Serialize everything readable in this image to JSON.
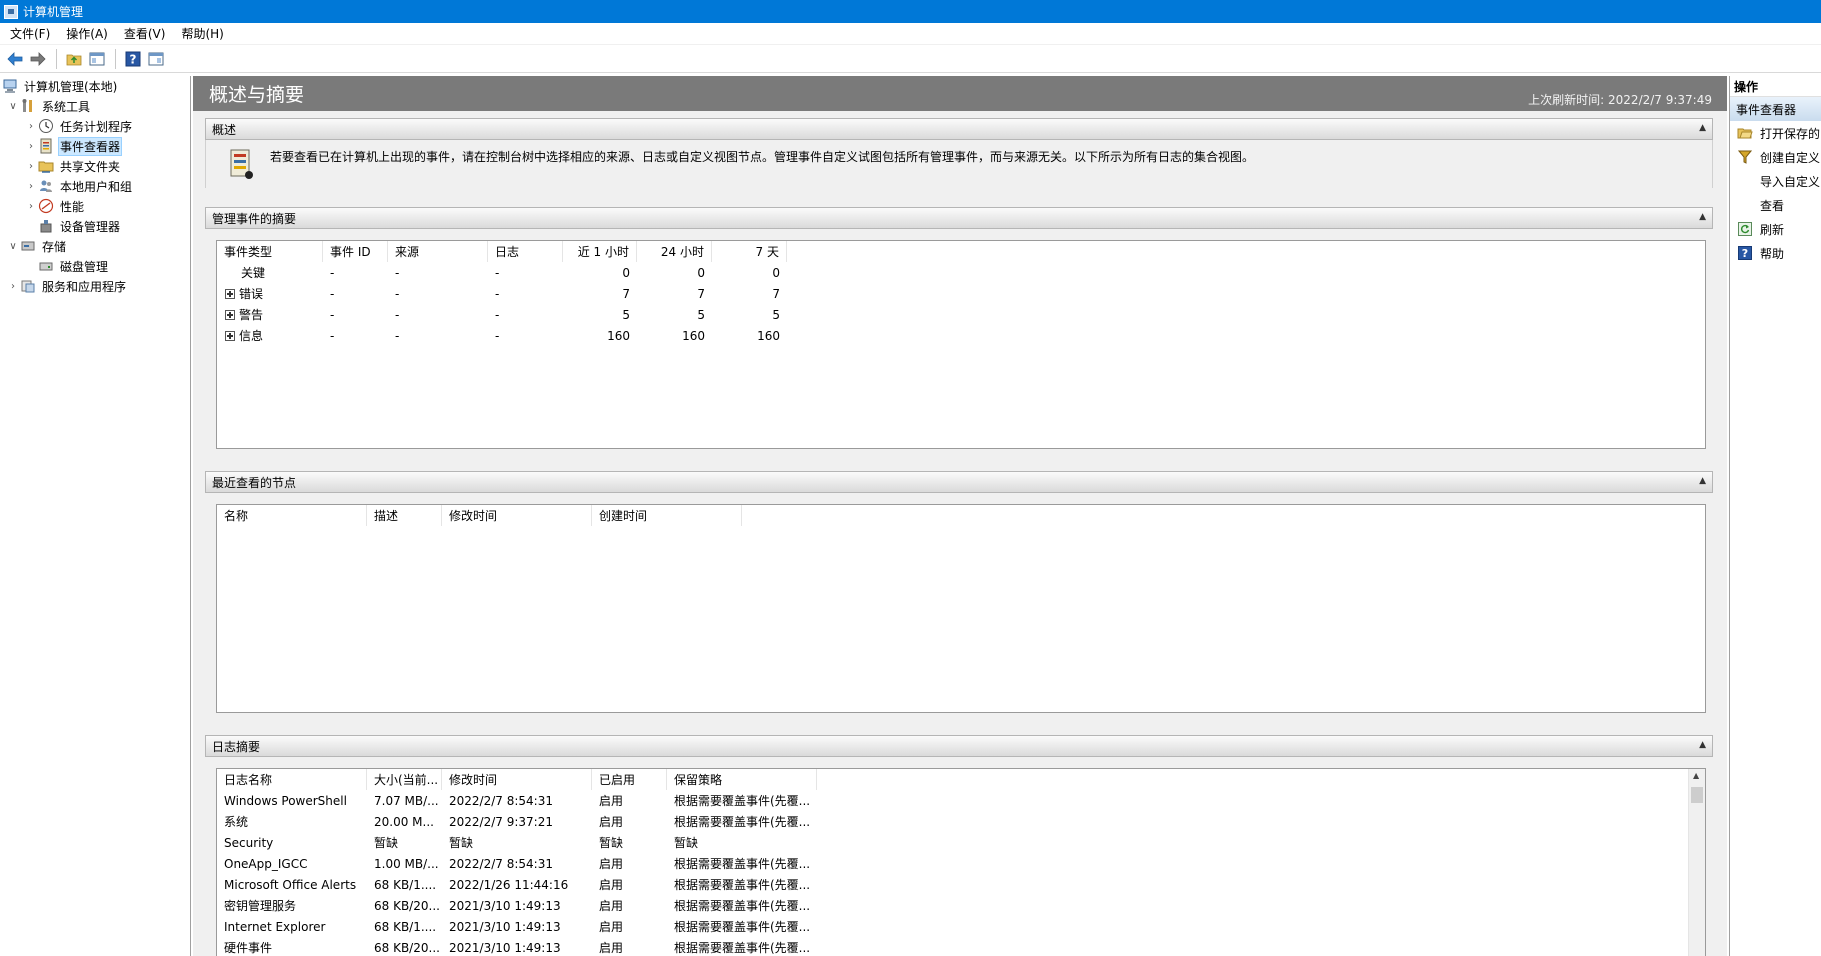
{
  "window": {
    "title": "计算机管理"
  },
  "menu": [
    "文件(F)",
    "操作(A)",
    "查看(V)",
    "帮助(H)"
  ],
  "toolbar": {
    "icons": [
      "back-icon",
      "forward-icon",
      "up-folder-icon",
      "show-hide-tree-icon",
      "help-icon",
      "show-hide-action-pane-icon"
    ]
  },
  "tree": {
    "root": "计算机管理(本地)",
    "system_tools": "系统工具",
    "task_scheduler": "任务计划程序",
    "event_viewer": "事件查看器",
    "shared_folders": "共享文件夹",
    "local_users": "本地用户和组",
    "performance": "性能",
    "device_manager": "设备管理器",
    "storage": "存储",
    "disk_management": "磁盘管理",
    "services_apps": "服务和应用程序"
  },
  "header": {
    "title": "概述与摘要",
    "refresh": "上次刷新时间: 2022/2/7 9:37:49"
  },
  "overview": {
    "title": "概述",
    "text": "若要查看已在计算机上出现的事件，请在控制台树中选择相应的来源、日志或自定义视图节点。管理事件自定义试图包括所有管理事件，而与来源无关。以下所示为所有日志的集合视图。"
  },
  "admin_summary": {
    "title": "管理事件的摘要",
    "columns": [
      "事件类型",
      "事件 ID",
      "来源",
      "日志",
      "近 1 小时",
      "24 小时",
      "7 天"
    ],
    "rows": [
      {
        "type": "关键",
        "id": "-",
        "source": "-",
        "log": "-",
        "h1": "0",
        "h24": "0",
        "d7": "0",
        "expandable": false
      },
      {
        "type": "错误",
        "id": "-",
        "source": "-",
        "log": "-",
        "h1": "7",
        "h24": "7",
        "d7": "7",
        "expandable": true
      },
      {
        "type": "警告",
        "id": "-",
        "source": "-",
        "log": "-",
        "h1": "5",
        "h24": "5",
        "d7": "5",
        "expandable": true
      },
      {
        "type": "信息",
        "id": "-",
        "source": "-",
        "log": "-",
        "h1": "160",
        "h24": "160",
        "d7": "160",
        "expandable": true
      }
    ]
  },
  "recent_nodes": {
    "title": "最近查看的节点",
    "columns": [
      "名称",
      "描述",
      "修改时间",
      "创建时间"
    ]
  },
  "log_summary": {
    "title": "日志摘要",
    "columns": [
      "日志名称",
      "大小(当前...",
      "修改时间",
      "已启用",
      "保留策略"
    ],
    "rows": [
      [
        "Windows PowerShell",
        "7.07 MB/...",
        "2022/2/7 8:54:31",
        "启用",
        "根据需要覆盖事件(先覆..."
      ],
      [
        "系统",
        "20.00 M...",
        "2022/2/7 9:37:21",
        "启用",
        "根据需要覆盖事件(先覆..."
      ],
      [
        "Security",
        "暂缺",
        "暂缺",
        "暂缺",
        "暂缺"
      ],
      [
        "OneApp_IGCC",
        "1.00 MB/...",
        "2022/2/7 8:54:31",
        "启用",
        "根据需要覆盖事件(先覆..."
      ],
      [
        "Microsoft Office Alerts",
        "68 KB/1....",
        "2022/1/26 11:44:16",
        "启用",
        "根据需要覆盖事件(先覆..."
      ],
      [
        "密钥管理服务",
        "68 KB/20...",
        "2021/3/10 1:49:13",
        "启用",
        "根据需要覆盖事件(先覆..."
      ],
      [
        "Internet Explorer",
        "68 KB/1....",
        "2021/3/10 1:49:13",
        "启用",
        "根据需要覆盖事件(先覆..."
      ],
      [
        "硬件事件",
        "68 KB/20...",
        "2021/3/10 1:49:13",
        "启用",
        "根据需要覆盖事件(先覆..."
      ]
    ]
  },
  "actions": {
    "title": "操作",
    "subtitle": "事件查看器",
    "items": [
      {
        "label": "打开保存的",
        "icon": "open-folder-icon"
      },
      {
        "label": "创建自定义",
        "icon": "filter-icon"
      },
      {
        "label": "导入自定义",
        "icon": ""
      },
      {
        "label": "查看",
        "icon": ""
      },
      {
        "label": "刷新",
        "icon": "refresh-icon"
      },
      {
        "label": "帮助",
        "icon": "help-icon"
      }
    ]
  }
}
